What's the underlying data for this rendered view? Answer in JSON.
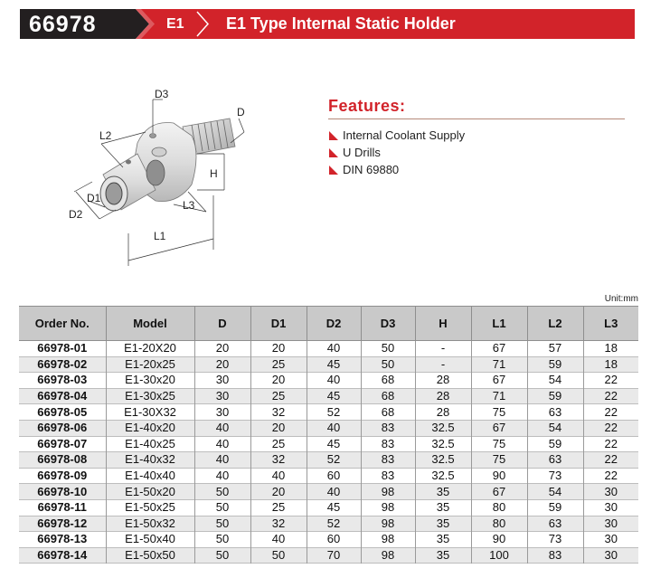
{
  "header": {
    "code": "66978",
    "series": "E1",
    "title": "E1 Type Internal Static Holder",
    "colors": {
      "dark": "#231f20",
      "red": "#d2232a"
    }
  },
  "drawing": {
    "labels": {
      "D3": "D3",
      "D": "D",
      "L2": "L2",
      "H": "H",
      "D1": "D1",
      "D2": "D2",
      "L3": "L3",
      "L1": "L1"
    }
  },
  "features": {
    "title": "Features:",
    "items": [
      "Internal Coolant Supply",
      "U Drills",
      "DIN 69880"
    ],
    "bullet_icon": "red-triangle-icon"
  },
  "unit": "Unit:mm",
  "table": {
    "headers": [
      "Order No.",
      "Model",
      "D",
      "D1",
      "D2",
      "D3",
      "H",
      "L1",
      "L2",
      "L3"
    ],
    "rows": [
      [
        "66978-01",
        "E1-20X20",
        "20",
        "20",
        "40",
        "50",
        "-",
        "67",
        "57",
        "18"
      ],
      [
        "66978-02",
        "E1-20x25",
        "20",
        "25",
        "45",
        "50",
        "-",
        "71",
        "59",
        "18"
      ],
      [
        "66978-03",
        "E1-30x20",
        "30",
        "20",
        "40",
        "68",
        "28",
        "67",
        "54",
        "22"
      ],
      [
        "66978-04",
        "E1-30x25",
        "30",
        "25",
        "45",
        "68",
        "28",
        "71",
        "59",
        "22"
      ],
      [
        "66978-05",
        "E1-30X32",
        "30",
        "32",
        "52",
        "68",
        "28",
        "75",
        "63",
        "22"
      ],
      [
        "66978-06",
        "E1-40x20",
        "40",
        "20",
        "40",
        "83",
        "32.5",
        "67",
        "54",
        "22"
      ],
      [
        "66978-07",
        "E1-40x25",
        "40",
        "25",
        "45",
        "83",
        "32.5",
        "75",
        "59",
        "22"
      ],
      [
        "66978-08",
        "E1-40x32",
        "40",
        "32",
        "52",
        "83",
        "32.5",
        "75",
        "63",
        "22"
      ],
      [
        "66978-09",
        "E1-40x40",
        "40",
        "40",
        "60",
        "83",
        "32.5",
        "90",
        "73",
        "22"
      ],
      [
        "66978-10",
        "E1-50x20",
        "50",
        "20",
        "40",
        "98",
        "35",
        "67",
        "54",
        "30"
      ],
      [
        "66978-11",
        "E1-50x25",
        "50",
        "25",
        "45",
        "98",
        "35",
        "80",
        "59",
        "30"
      ],
      [
        "66978-12",
        "E1-50x32",
        "50",
        "32",
        "52",
        "98",
        "35",
        "80",
        "63",
        "30"
      ],
      [
        "66978-13",
        "E1-50x40",
        "50",
        "40",
        "60",
        "98",
        "35",
        "90",
        "73",
        "30"
      ],
      [
        "66978-14",
        "E1-50x50",
        "50",
        "50",
        "70",
        "98",
        "35",
        "100",
        "83",
        "30"
      ]
    ]
  }
}
